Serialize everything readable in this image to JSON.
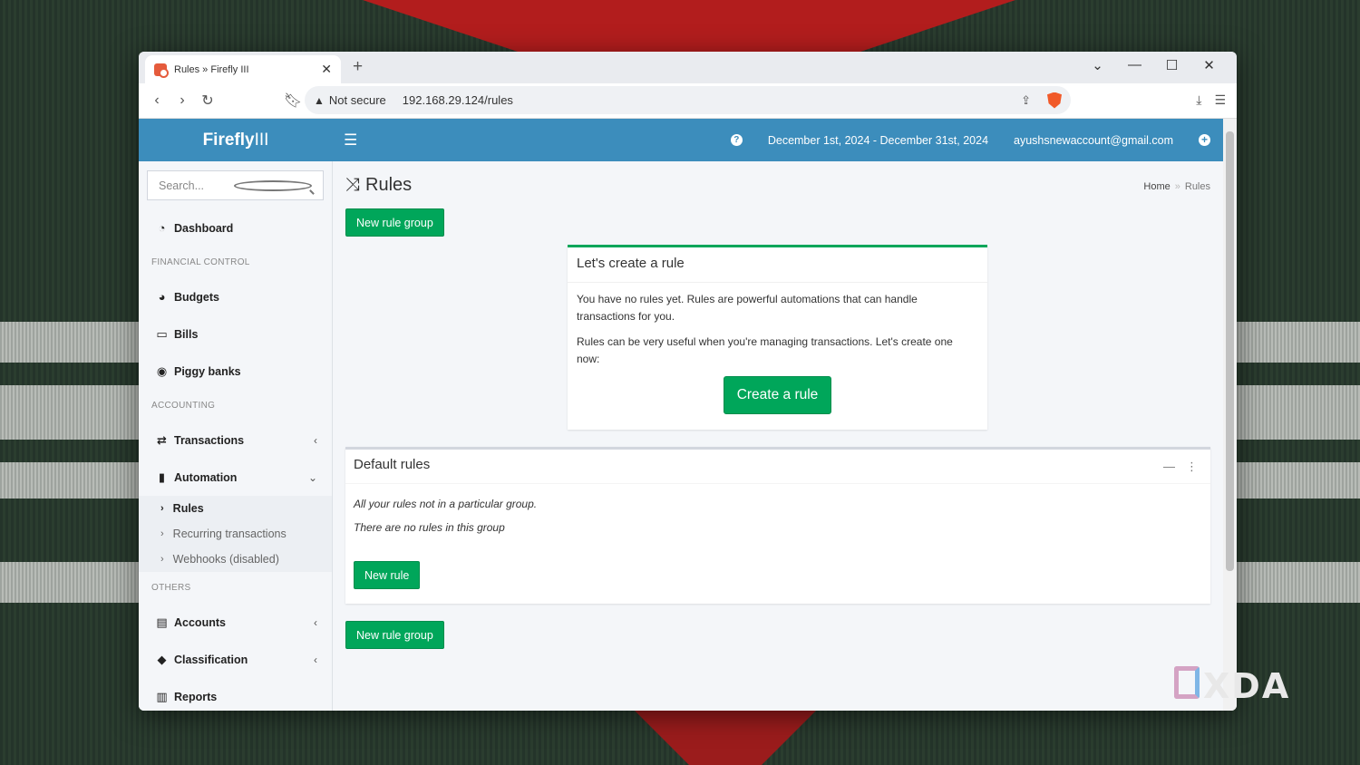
{
  "browser": {
    "tab_title": "Rules » Firefly III",
    "new_tab": "+",
    "security_label": "Not secure",
    "url": "192.168.29.124/rules"
  },
  "app": {
    "brand_bold": "Firefly",
    "brand_light": "III",
    "date_range": "December 1st, 2024 - December 31st, 2024",
    "account_email": "ayushsnewaccount@gmail.com"
  },
  "sidebar": {
    "search_placeholder": "Search...",
    "dashboard": "Dashboard",
    "header_financial": "FINANCIAL CONTROL",
    "budgets": "Budgets",
    "bills": "Bills",
    "piggy": "Piggy banks",
    "header_accounting": "ACCOUNTING",
    "transactions": "Transactions",
    "automation": "Automation",
    "sub_rules": "Rules",
    "sub_recurring": "Recurring transactions",
    "sub_webhooks": "Webhooks (disabled)",
    "header_others": "OTHERS",
    "accounts": "Accounts",
    "classification": "Classification",
    "reports": "Reports"
  },
  "page": {
    "title": "Rules",
    "breadcrumb_home": "Home",
    "breadcrumb_sep": "»",
    "breadcrumb_current": "Rules",
    "new_rule_group": "New rule group",
    "intro_title": "Let's create a rule",
    "intro_p1": "You have no rules yet. Rules are powerful automations that can handle transactions for you.",
    "intro_p2": "Rules can be very useful when you're managing transactions. Let's create one now:",
    "create_rule": "Create a rule",
    "default_title": "Default rules",
    "default_desc": "All your rules not in a particular group.",
    "no_rules": "There are no rules in this group",
    "new_rule": "New rule",
    "new_rule_group_bottom": "New rule group"
  },
  "watermark": "XDA",
  "colors": {
    "header_blue": "#3c8dbc",
    "green": "#00a65a"
  }
}
